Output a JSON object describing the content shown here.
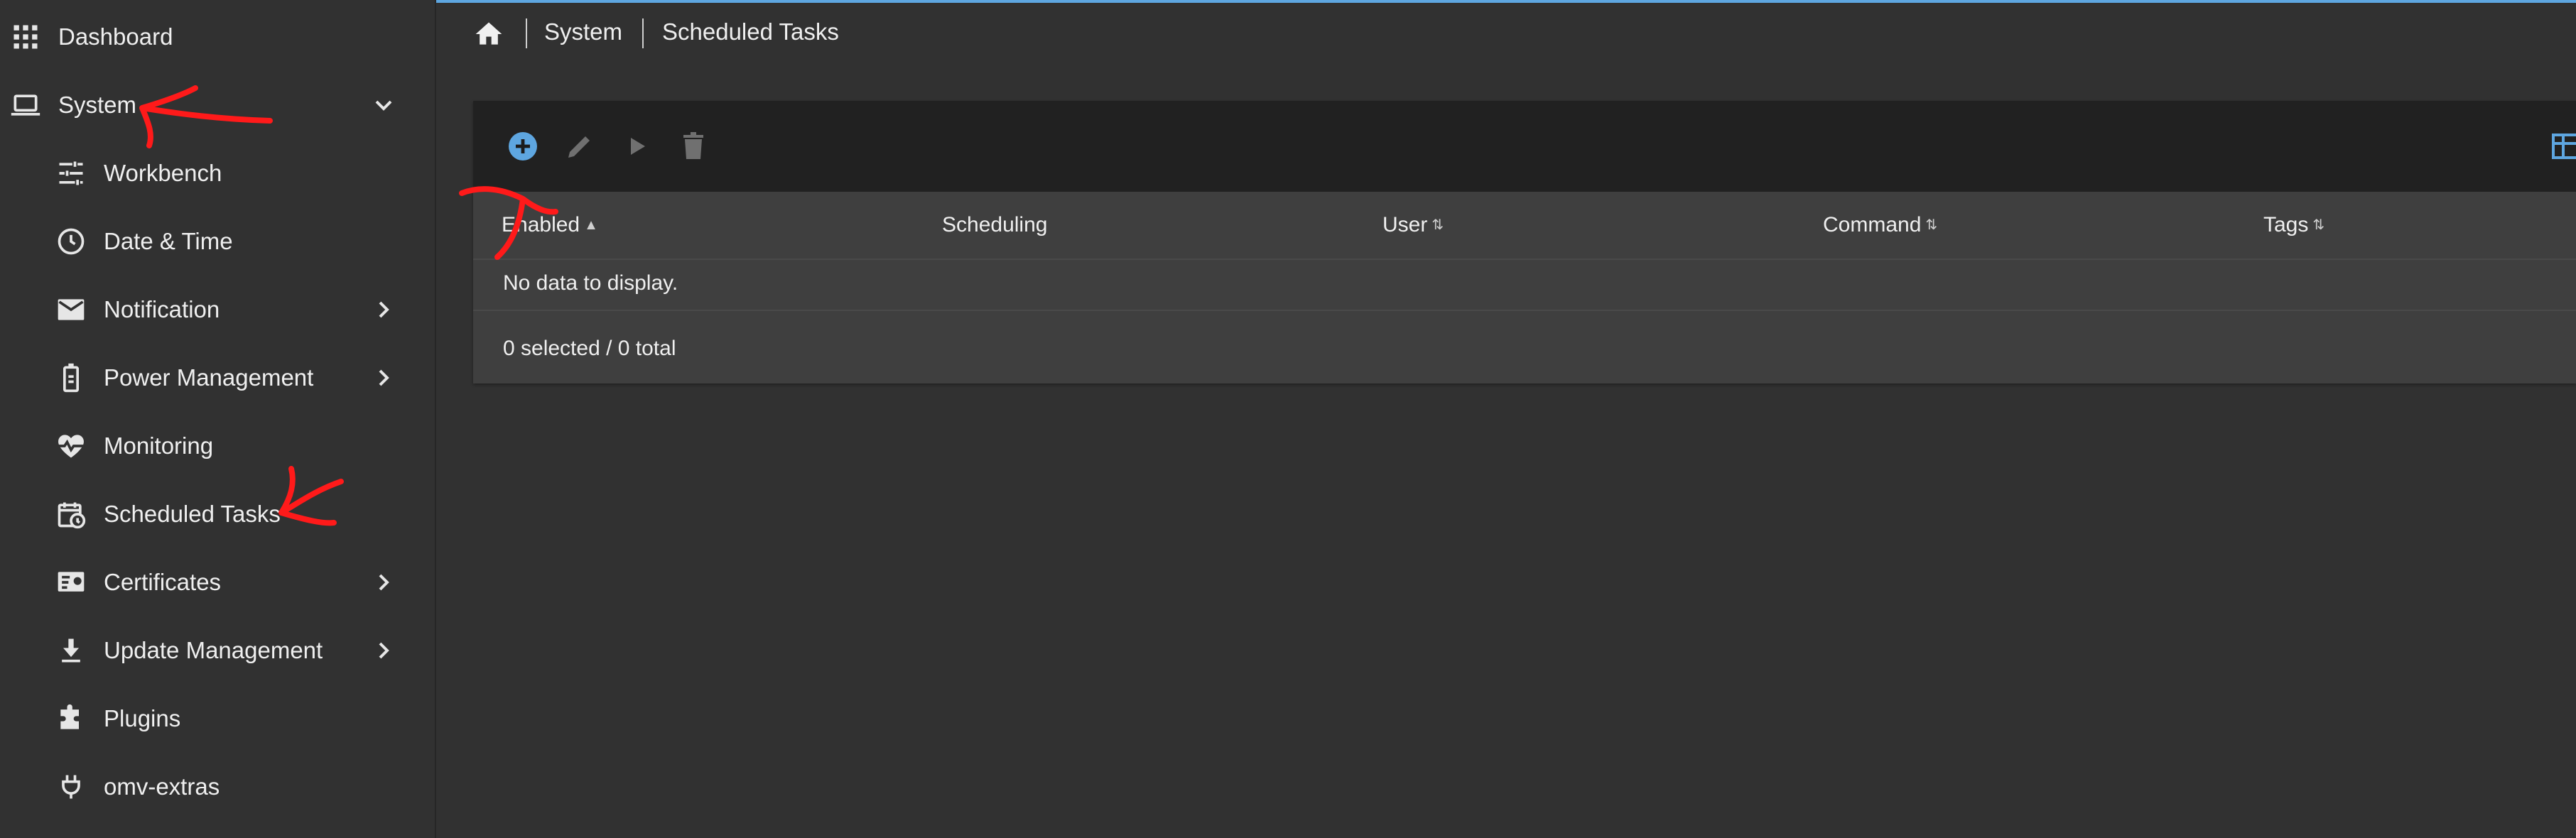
{
  "sidebar": {
    "items": [
      {
        "label": "Dashboard",
        "icon": "apps-grid-icon",
        "level": 0,
        "expandable": false
      },
      {
        "label": "System",
        "icon": "laptop-icon",
        "level": 0,
        "expandable": true,
        "expanded": true
      },
      {
        "label": "Workbench",
        "icon": "tune-sliders-icon",
        "level": 1,
        "expandable": false
      },
      {
        "label": "Date & Time",
        "icon": "clock-icon",
        "level": 1,
        "expandable": false
      },
      {
        "label": "Notification",
        "icon": "mail-icon",
        "level": 1,
        "expandable": true
      },
      {
        "label": "Power Management",
        "icon": "battery-icon",
        "level": 1,
        "expandable": true
      },
      {
        "label": "Monitoring",
        "icon": "heart-pulse-icon",
        "level": 1,
        "expandable": false
      },
      {
        "label": "Scheduled Tasks",
        "icon": "calendar-clock-icon",
        "level": 1,
        "expandable": false
      },
      {
        "label": "Certificates",
        "icon": "certificate-icon",
        "level": 1,
        "expandable": true
      },
      {
        "label": "Update Management",
        "icon": "download-icon",
        "level": 1,
        "expandable": true
      },
      {
        "label": "Plugins",
        "icon": "puzzle-icon",
        "level": 1,
        "expandable": false
      },
      {
        "label": "omv-extras",
        "icon": "power-plug-icon",
        "level": 1,
        "expandable": false
      }
    ]
  },
  "breadcrumb": {
    "home_icon": "home-icon",
    "items": [
      "System",
      "Scheduled Tasks"
    ]
  },
  "table": {
    "toolbar": {
      "add_icon": "add-circle-icon",
      "edit_icon": "pencil-icon",
      "run_icon": "play-icon",
      "delete_icon": "trash-icon",
      "columns_icon": "table-columns-icon"
    },
    "columns": [
      {
        "label": "Enabled",
        "sort": "asc"
      },
      {
        "label": "Scheduling",
        "sort": "none"
      },
      {
        "label": "User",
        "sort": "both"
      },
      {
        "label": "Command",
        "sort": "both"
      },
      {
        "label": "Tags",
        "sort": "both"
      }
    ],
    "empty_text": "No data to display.",
    "footer": "0 selected / 0 total"
  },
  "colors": {
    "accent": "#5ea6e0",
    "background": "#313131",
    "toolbar": "#212121",
    "card": "#3f3f3f",
    "annotation": "#ff1a1a"
  }
}
